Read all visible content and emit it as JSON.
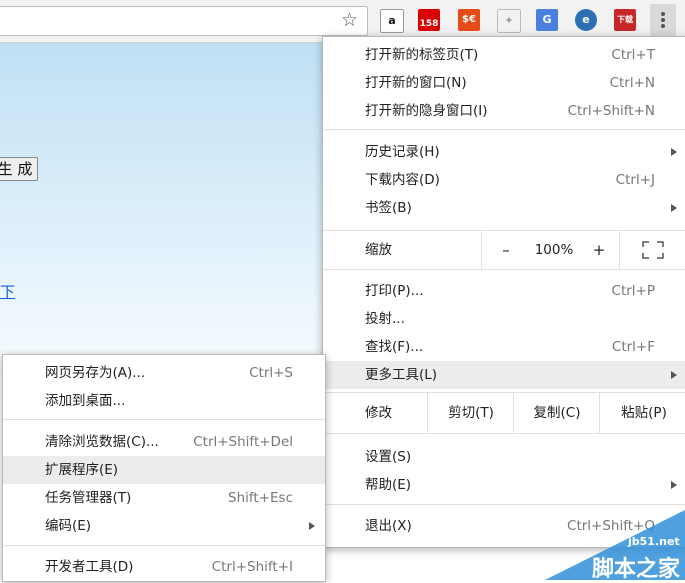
{
  "toolbar": {
    "extensions": [
      {
        "name": "amazon-icon",
        "glyph": "a",
        "bg": "#ffffff",
        "fg": "#111111"
      },
      {
        "name": "badge-158-icon",
        "glyph": "158",
        "bg": "#d90000",
        "fg": "#ffffff"
      },
      {
        "name": "currency-icon",
        "glyph": "$€",
        "bg": "#e64a19",
        "fg": "#ffffff"
      },
      {
        "name": "shield-icon",
        "glyph": "✦",
        "bg": "#f2f2f2",
        "fg": "#9e9e9e"
      },
      {
        "name": "translate-icon",
        "glyph": "G",
        "bg": "#4a7fe0",
        "fg": "#ffffff"
      },
      {
        "name": "e-icon",
        "glyph": "e",
        "bg": "#2c6fb3",
        "fg": "#ffffff"
      },
      {
        "name": "download-icon",
        "glyph": "下载",
        "bg": "#c62828",
        "fg": "#ffffff"
      }
    ]
  },
  "page": {
    "button_label": "生 成",
    "link_text": "下"
  },
  "main_menu": {
    "items": [
      {
        "label": "打开新的标签页(T)",
        "shortcut": "Ctrl+T"
      },
      {
        "label": "打开新的窗口(N)",
        "shortcut": "Ctrl+N"
      },
      {
        "label": "打开新的隐身窗口(I)",
        "shortcut": "Ctrl+Shift+N"
      },
      {
        "label": "历史记录(H)",
        "shortcut": ""
      },
      {
        "label": "下载内容(D)",
        "shortcut": "Ctrl+J"
      },
      {
        "label": "书签(B)",
        "shortcut": ""
      },
      {
        "label": "打印(P)...",
        "shortcut": "Ctrl+P"
      },
      {
        "label": "投射...",
        "shortcut": ""
      },
      {
        "label": "查找(F)...",
        "shortcut": "Ctrl+F"
      },
      {
        "label": "更多工具(L)",
        "shortcut": ""
      },
      {
        "label": "设置(S)",
        "shortcut": ""
      },
      {
        "label": "帮助(E)",
        "shortcut": ""
      },
      {
        "label": "退出(X)",
        "shortcut": "Ctrl+Shift+Q"
      }
    ],
    "zoom": {
      "label": "缩放",
      "minus": "–",
      "value": "100%",
      "plus": "+"
    },
    "edit": {
      "label": "修改",
      "cut": "剪切(T)",
      "copy": "复制(C)",
      "paste": "粘贴(P)"
    }
  },
  "sub_menu": {
    "items": [
      {
        "label": "网页另存为(A)...",
        "shortcut": "Ctrl+S"
      },
      {
        "label": "添加到桌面...",
        "shortcut": ""
      },
      {
        "label": "清除浏览数据(C)...",
        "shortcut": "Ctrl+Shift+Del"
      },
      {
        "label": "扩展程序(E)",
        "shortcut": ""
      },
      {
        "label": "任务管理器(T)",
        "shortcut": "Shift+Esc"
      },
      {
        "label": "编码(E)",
        "shortcut": ""
      },
      {
        "label": "开发者工具(D)",
        "shortcut": "Ctrl+Shift+I"
      }
    ]
  },
  "watermark": {
    "site": "jb51.net",
    "name": "脚本之家"
  }
}
